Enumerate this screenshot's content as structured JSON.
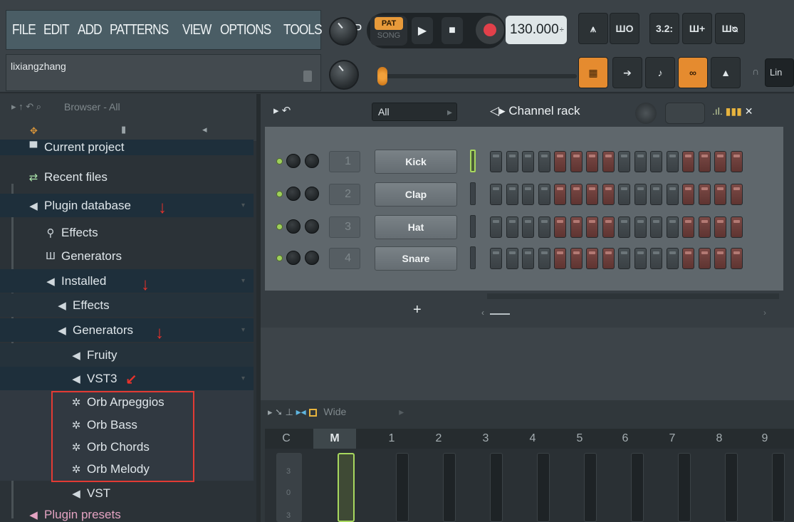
{
  "menu": {
    "items": [
      "FILE",
      "EDIT",
      "ADD",
      "PATTERNS",
      "VIEW",
      "OPTIONS",
      "TOOLS",
      "HELP"
    ]
  },
  "hint": {
    "text": "lixiangzhang"
  },
  "transport": {
    "pat_label": "PAT",
    "song_label": "SONG",
    "tempo": "130.000",
    "tempo_suffix": "÷"
  },
  "toolbar": {
    "icons": [
      "metronome-icon",
      "wait-icon",
      "countdown-icon",
      "blend-icon",
      "loop-record-icon"
    ],
    "labels": [
      "3.2:",
      "Ш+",
      "Шᴓ",
      "ШО"
    ]
  },
  "toolbar2": {
    "right_label": "Lin"
  },
  "browser": {
    "title": "Browser - All",
    "items": [
      {
        "label": "Current project",
        "icon": "folder-icon"
      },
      {
        "label": "Recent files",
        "icon": "recent-icon"
      },
      {
        "label": "Plugin database",
        "icon": "plugin-icon"
      },
      {
        "label": "Effects",
        "icon": "effects-icon"
      },
      {
        "label": "Generators",
        "icon": "generators-icon"
      },
      {
        "label": "Installed",
        "icon": "plugin-icon"
      },
      {
        "label": "Effects",
        "icon": "plugin-icon"
      },
      {
        "label": "Generators",
        "icon": "plugin-icon"
      },
      {
        "label": "Fruity",
        "icon": "plugin-icon"
      },
      {
        "label": "VST3",
        "icon": "plugin-icon"
      },
      {
        "label": "Orb Arpeggios",
        "icon": "orb-icon"
      },
      {
        "label": "Orb Bass",
        "icon": "orb-icon"
      },
      {
        "label": "Orb Chords",
        "icon": "orb-icon"
      },
      {
        "label": "Orb Melody",
        "icon": "orb-icon"
      },
      {
        "label": "VST",
        "icon": "plugin-icon"
      },
      {
        "label": "Plugin presets",
        "icon": "plugin-icon"
      }
    ]
  },
  "channel_rack": {
    "filter": "All",
    "title": "Channel rack",
    "add_label": "+",
    "channels": [
      {
        "num": "1",
        "name": "Kick"
      },
      {
        "num": "2",
        "name": "Clap"
      },
      {
        "num": "3",
        "name": "Hat"
      },
      {
        "num": "4",
        "name": "Snare"
      }
    ]
  },
  "mixer": {
    "view_label": "Wide",
    "columns": [
      "C",
      "M",
      "1",
      "2",
      "3",
      "4",
      "5",
      "6",
      "7",
      "8",
      "9"
    ],
    "strip_labels": [
      "3",
      "0",
      "3"
    ]
  },
  "colors": {
    "accent": "#e58b2f",
    "selection": "#e23b34",
    "green": "#a7d85e"
  }
}
